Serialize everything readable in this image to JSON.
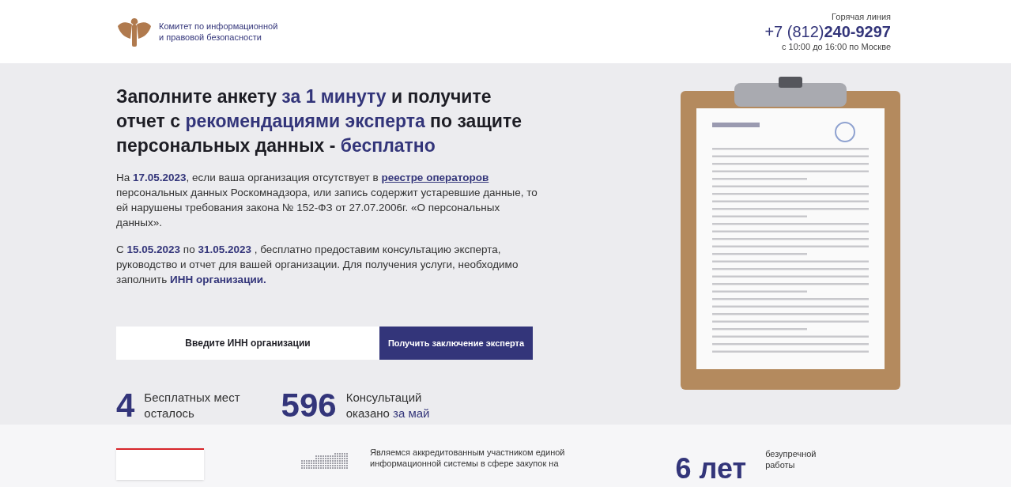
{
  "header": {
    "org_name_lines": [
      "Комитет по информационной",
      "и правовой безопасности"
    ],
    "hotline": {
      "label": "Горячая линия",
      "phone_code": "+7 (812)",
      "phone_number": "240-9297",
      "hours": "с 10:00 до 16:00 по Москве"
    }
  },
  "hero": {
    "heading": [
      {
        "text": "Заполните анкету ",
        "accent": false
      },
      {
        "text": "за 1 минуту",
        "accent": true
      },
      {
        "text": " и получите отчет с ",
        "accent": false
      },
      {
        "text": "рекомендациями эксперта",
        "accent": true
      },
      {
        "text": " по защите персональных данных - ",
        "accent": false
      },
      {
        "text": "бесплатно",
        "accent": true
      }
    ],
    "paragraphs": [
      [
        {
          "kind": "text",
          "text": "На **17.05.2023**, если ваша организация отсутствует в "
        },
        {
          "kind": "link",
          "text": "реестре операторов"
        },
        {
          "kind": "text",
          "text": " персональных данных Роскомнадзора, или запись содержит устаревшие данные, то ей нарушены требования закона № 152-ФЗ от 27.07.2006г. «О персональных данных»."
        }
      ],
      [
        {
          "kind": "text",
          "text": "С **15.05.2023** по **31.05.2023** , бесплатно предоставим консультацию эксперта, руководство и отчет для вашей организации. Для получения услуги, необходимо заполнить **ИНН организации.**"
        }
      ]
    ],
    "inn_field": {
      "placeholder": "Введите ИНН организации"
    },
    "submit_button": "Получить заключение эксперта",
    "stats": [
      {
        "value": "4",
        "label_lines": [
          [
            {
              "text": "Бесплатных мест",
              "accent": false
            }
          ],
          [
            {
              "text": "осталось",
              "accent": false
            }
          ]
        ]
      },
      {
        "value": "596",
        "label_lines": [
          [
            {
              "text": "Консультаций",
              "accent": false
            }
          ],
          [
            {
              "text": "оказано ",
              "accent": false
            },
            {
              "text": "за май",
              "accent": true
            }
          ]
        ]
      }
    ]
  },
  "features": {
    "accreditation_lines": [
      "Являемся аккредитованным участником единой",
      "информационной системы в сфере закупок на"
    ],
    "years": "6 лет",
    "years_caption_lines": [
      "безупречной",
      "работы"
    ]
  }
}
